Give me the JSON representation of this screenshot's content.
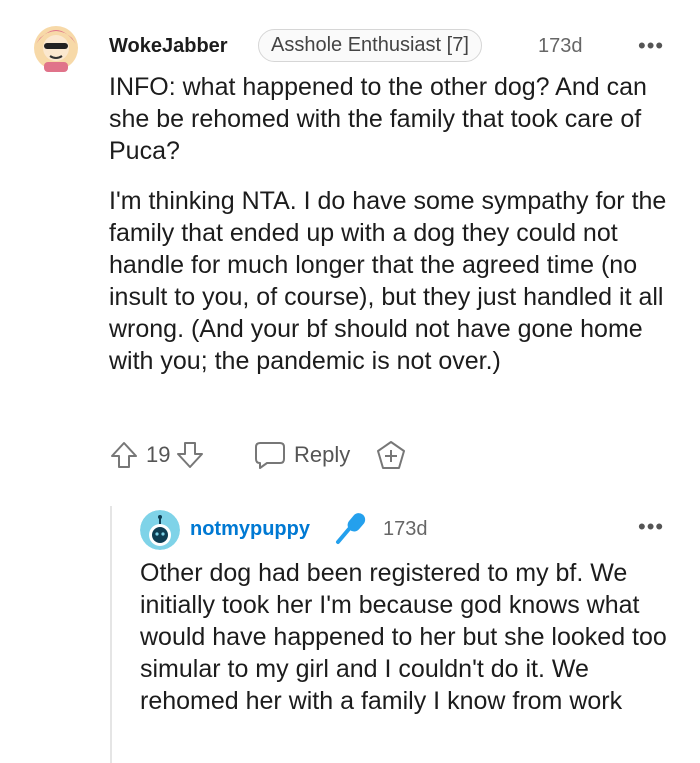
{
  "comment": {
    "username": "WokeJabber",
    "flair": "Asshole Enthusiast [7]",
    "time": "173d",
    "more": "•••",
    "paragraphs": [
      "INFO: what happened to the other dog? And can she be rehomed with the family that took care of Puca?",
      "I'm thinking NTA. I do have some sympathy for the family that ended up with a dog they could not handle for much longer that the agreed time (no insult to you, of course), but they just handled it all wrong. (And your bf should not have gone home with you; the pandemic is not over.)"
    ],
    "votes": "19",
    "reply_label": "Reply"
  },
  "reply": {
    "username": "notmypuppy",
    "time": "173d",
    "more": "•••",
    "text": "Other dog had been registered to my bf. We initially took her I'm because god knows what would have happened to her but she looked too simular to my girl and I couldn't do it. We rehomed her with a family I know from work"
  },
  "icons": {
    "upvote": "upvote-arrow-icon",
    "downvote": "downvote-arrow-icon",
    "reply": "speech-bubble-icon",
    "award": "add-award-icon",
    "op": "microphone-icon"
  },
  "colors": {
    "accent": "#0079d3",
    "op_mic": "#24a0ed"
  }
}
